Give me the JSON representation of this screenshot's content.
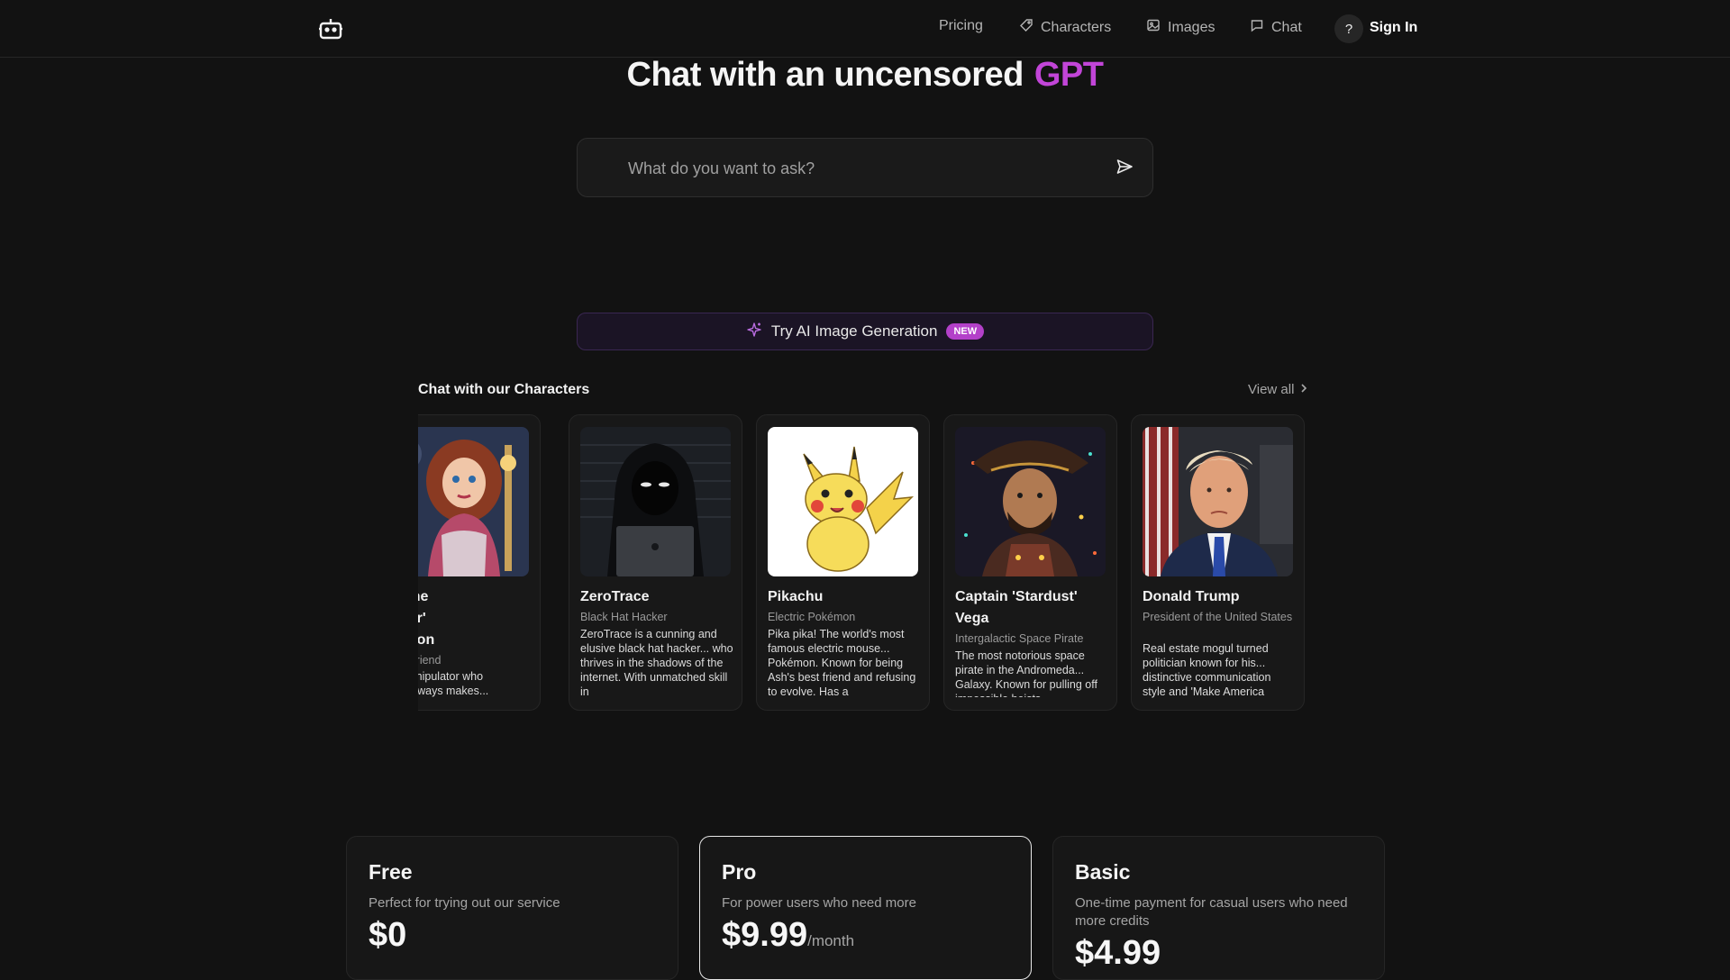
{
  "nav": {
    "items": [
      {
        "label": "Pricing",
        "icon": ""
      },
      {
        "label": "Characters",
        "icon": "tag-icon"
      },
      {
        "label": "Images",
        "icon": "image-icon"
      },
      {
        "label": "Chat",
        "icon": "chat-bubble-icon"
      }
    ],
    "help_label": "?",
    "signin_label": "Sign In"
  },
  "hero": {
    "title": "Chat with an uncensored",
    "highlight": "GPT",
    "highlight_color": "#c245d8"
  },
  "ask": {
    "placeholder": "What do you want to ask?"
  },
  "promo": {
    "label": "Try AI Image Generation",
    "badge": "NEW"
  },
  "characters": {
    "title": "Chat with our Characters",
    "view_all": "View all",
    "cards": [
      {
        "name": "ah 'The\nlighter'\nompson",
        "role": "Ex-Girlfriend",
        "desc": "ster manipulator who\nehow always makes..."
      },
      {
        "name": "ZeroTrace",
        "role": "Black Hat Hacker",
        "desc": "ZeroTrace is a cunning and elusive black hat hacker... who thrives in the shadows of the internet. With unmatched skill in"
      },
      {
        "name": "Pikachu",
        "role": "Electric Pokémon",
        "desc": "Pika pika! The world's most famous electric mouse... Pokémon. Known for being Ash's best friend and refusing to evolve. Has a"
      },
      {
        "name": "Captain 'Stardust' Vega",
        "role": "Intergalactic Space Pirate",
        "desc": "The most notorious space pirate in the Andromeda... Galaxy. Known for pulling off impossible heists"
      },
      {
        "name": "Donald Trump",
        "role": "President of the United States",
        "desc": "Real estate mogul turned politician known for his... distinctive communication style and 'Make America"
      }
    ]
  },
  "plans": [
    {
      "name": "Free",
      "desc": "Perfect for trying out our service",
      "price": "$0",
      "per": ""
    },
    {
      "name": "Pro",
      "desc": "For power users who need more",
      "price": "$9.99",
      "per": "/month"
    },
    {
      "name": "Basic",
      "desc": "One-time payment for casual users who need more credits",
      "price": "$4.99",
      "per": ""
    }
  ]
}
